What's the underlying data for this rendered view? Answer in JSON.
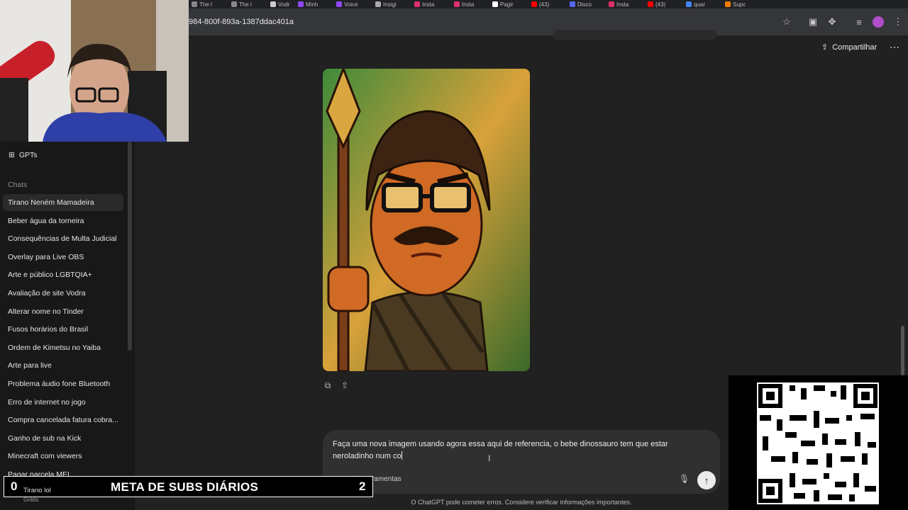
{
  "browser": {
    "tabs": [
      {
        "label": "The l",
        "color": "#888888"
      },
      {
        "label": "The l",
        "color": "#888888"
      },
      {
        "label": "Vodr",
        "color": "#cccccc"
      },
      {
        "label": "Minh",
        "color": "#9146ff"
      },
      {
        "label": "Voice",
        "color": "#9146ff"
      },
      {
        "label": "Insigi",
        "color": "#aaaaaa"
      },
      {
        "label": "Insta",
        "color": "#e1306c"
      },
      {
        "label": "Insta",
        "color": "#e1306c"
      },
      {
        "label": "Pagir",
        "color": "#ffffff"
      },
      {
        "label": "(43)",
        "color": "#ff0000"
      },
      {
        "label": "Disco",
        "color": "#5865f2"
      },
      {
        "label": "Insta",
        "color": "#e1306c"
      },
      {
        "label": "(43)",
        "color": "#ff0000"
      },
      {
        "label": "quar",
        "color": "#4285f4"
      },
      {
        "label": "Supc",
        "color": "#ff7a00"
      }
    ],
    "url": "984-800f-893a-1387ddac401a",
    "icons": [
      "star-icon",
      "cast-icon",
      "extensions-icon",
      "media-icon",
      "profile-avatar",
      "menu-icon"
    ]
  },
  "sidebar": {
    "gpts_label": "GPTs",
    "chats_label": "Chats",
    "chats": [
      "Tirano Neném Mamadeira",
      "Beber água da torneira",
      "Consequências de Multa Judicial",
      "Overlay para Live OBS",
      "Arte e público LGBTQIA+",
      "Avaliação de site Vodra",
      "Alterar nome no Tinder",
      "Fusos horários do Brasil",
      "Ordem de Kimetsu no Yaiba",
      "Arte para live",
      "Problema áudio fone Bluetooth",
      "Erro de internet no jogo",
      "Compra cancelada fatura cobra...",
      "Ganho de sub na Kick",
      "Minecraft com viewers",
      "Pagar parcela MEI"
    ],
    "active_index": 0,
    "profile_name": "Tirano lol",
    "profile_plan": "Grátis"
  },
  "header": {
    "share_label": "Compartilhar",
    "more_icon": "⋯"
  },
  "composer": {
    "text": "Faça uma nova imagem usando agora essa aqui de referencia, o bebe dinossauro tem que estar neroladinho num co",
    "tools_label": "Ferramentas",
    "plus_icon": "+",
    "send_icon": "↑"
  },
  "disclaimer": "O ChatGPT pode cometer erros. Considere verificar informações importantes.",
  "subs_goal": {
    "current": "0",
    "title": "META DE SUBS DIÁRIOS",
    "goal": "2"
  }
}
